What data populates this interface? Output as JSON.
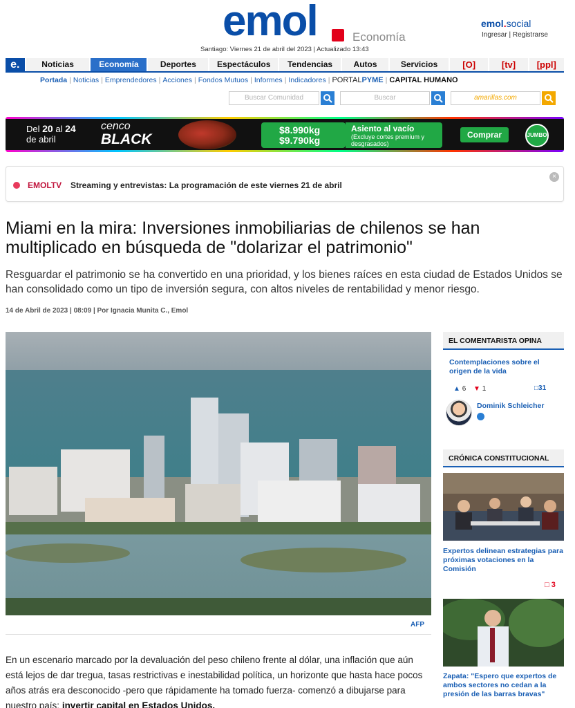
{
  "header": {
    "logo": "emol",
    "section": "Economía",
    "dateline": "Santiago: Viernes 21 de abril del 2023 | Actualizado 13:43",
    "social_brand": "emol",
    "social_suffix": "social",
    "login": "Ingresar",
    "register": "Registrarse"
  },
  "nav": {
    "home_icon": "e.",
    "items": [
      "Noticias",
      "Economía",
      "Deportes",
      "Espectáculos",
      "Tendencias",
      "Autos",
      "Servicios"
    ],
    "active": "Economía",
    "icon_items": [
      "[O]",
      "[tv]",
      "[ppl]"
    ]
  },
  "subnav": {
    "items": [
      "Portada",
      "Noticias",
      "Emprendedores",
      "Acciones",
      "Fondos Mutuos",
      "Informes",
      "Indicadores"
    ],
    "portal_prefix": "PORTAL",
    "portal_suffix": "PYME",
    "capital": "CAPITAL HUMANO"
  },
  "search": {
    "community_placeholder": "Buscar Comunidad",
    "search_placeholder": "Buscar",
    "amarillas_placeholder": "amarillas.com"
  },
  "ad": {
    "dates_line1_prefix": "Del",
    "dates_from": "20",
    "dates_mid": "al",
    "dates_to": "24",
    "dates_line2": "de abril",
    "brand_top": "cenco",
    "brand_bottom": "BLACK",
    "price1": "$8.990kg",
    "price2": "$9.790kg",
    "promo_title": "Asiento al vacío",
    "promo_sub": "(Excluye cortes premium y desgrasados)",
    "buy": "Comprar",
    "store": "JUMBO"
  },
  "notice": {
    "tag": "EMOLTV",
    "text": "Streaming y entrevistas: La programación de este viernes 21 de abril",
    "close": "×"
  },
  "article": {
    "headline": "Miami en la mira: Inversiones inmobiliarias de chilenos se han multiplicado en búsqueda de \"dolarizar el patrimonio\"",
    "summary": "Resguardar el patrimonio se ha convertido en una prioridad, y los bienes raíces en esta ciudad de Estados Unidos se han consolidado como un tipo de inversión segura, con altos niveles de rentabilidad y menor riesgo.",
    "byline": "14 de Abril de 2023 | 08:09 | Por Ignacia Munita C., Emol",
    "photo_credit": "AFP",
    "body_lead": "En un escenario marcado por la devaluación del peso chileno frente al dólar, una inflación que aún está lejos de dar tregua, tasas restrictivas e inestabilidad política, un horizonte que hasta hace pocos años atrás era desconocido -pero que rápidamente ha tomado fuerza- comenzó a dibujarse para nuestro país: ",
    "body_bold": "invertir capital en Estados Unidos."
  },
  "sidebar": {
    "opina_title": "EL COMENTARISTA OPINA",
    "opina_link": "Contemplaciones sobre el origen de la vida",
    "likes": "6",
    "dislikes": "1",
    "comments": "31",
    "author": "Dominik Schleicher",
    "cronica_title": "CRÓNICA CONSTITUCIONAL",
    "story1": "Expertos delinean estrategias para próximas votaciones en la Comisión",
    "story1_comments": "3",
    "story2": "Zapata: \"Espero que expertos de ambos sectores no cedan a la presión de las barras bravas\""
  },
  "colors": {
    "brand_blue": "#0a4ea8",
    "brand_red": "#e2001a",
    "link_blue": "#1a5fb4",
    "active_nav": "#2a6fc9"
  }
}
